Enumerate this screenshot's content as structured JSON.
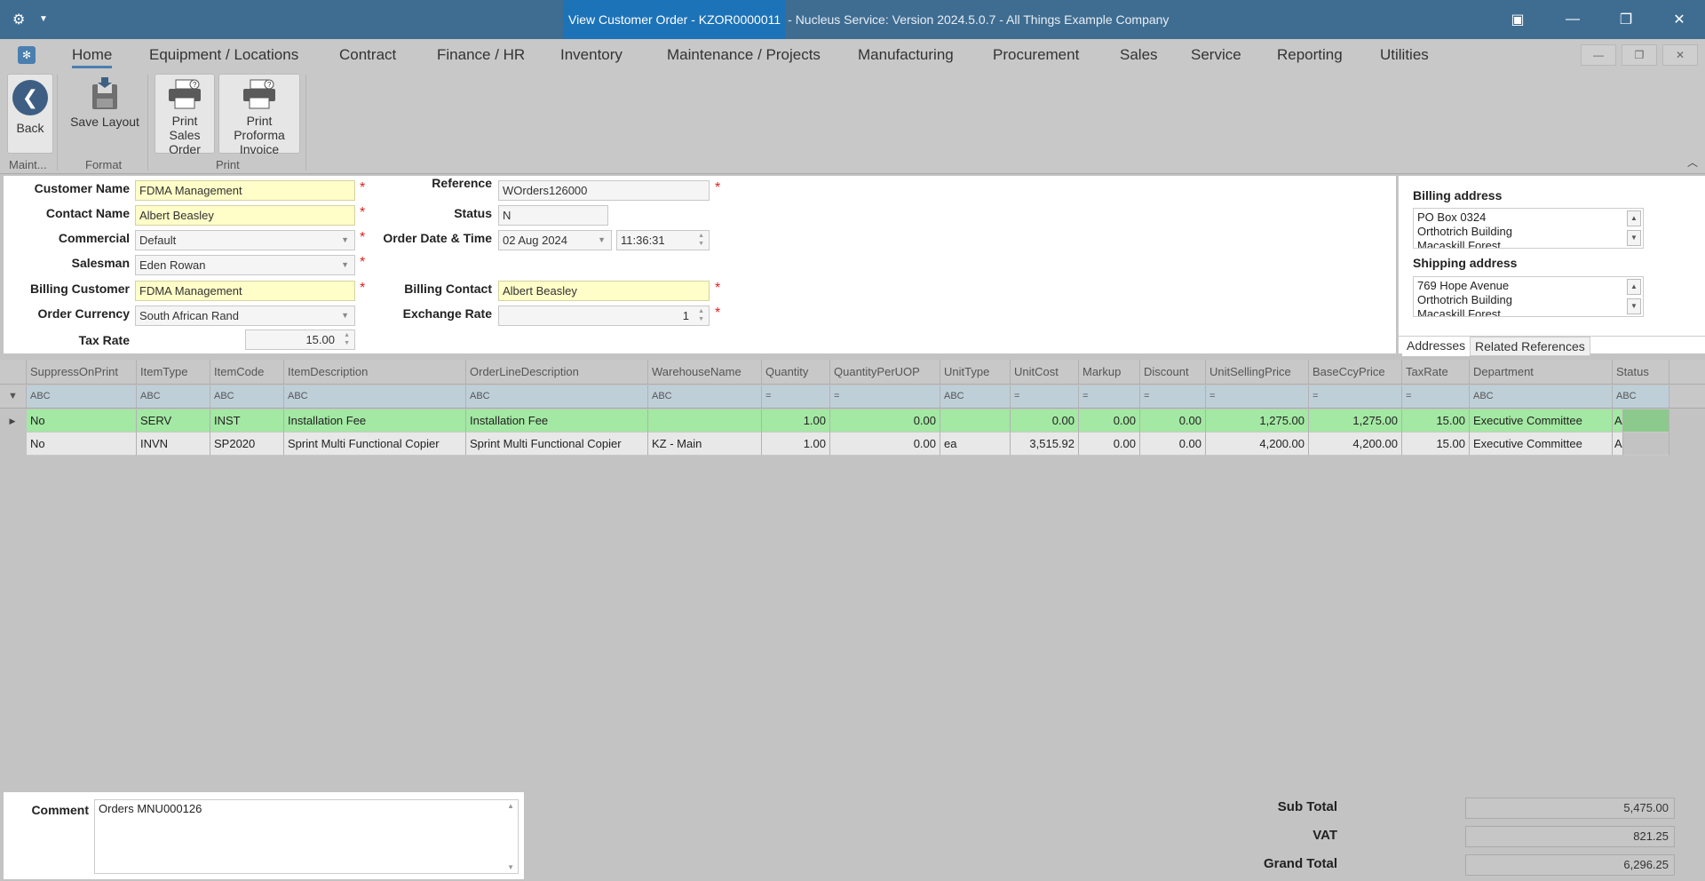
{
  "window": {
    "title_highlight": "View Customer Order - KZOR0000011",
    "title_rest": "- Nucleus Service: Version 2024.5.0.7 - All Things Example Company"
  },
  "menu": {
    "items": [
      "Home",
      "Equipment / Locations",
      "Contract",
      "Finance / HR",
      "Inventory",
      "Maintenance / Projects",
      "Manufacturing",
      "Procurement",
      "Sales",
      "Service",
      "Reporting",
      "Utilities"
    ]
  },
  "ribbon": {
    "back": "Back",
    "save_layout": "Save Layout",
    "print_sales_order": [
      "Print Sales",
      "Order"
    ],
    "print_proforma": [
      "Print Proforma",
      "Invoice"
    ],
    "groups": [
      "Maint...",
      "Format",
      "Print"
    ]
  },
  "form": {
    "customer_name_label": "Customer Name",
    "customer_name": "FDMA Management",
    "contact_name_label": "Contact Name",
    "contact_name": "Albert Beasley",
    "commercial_label": "Commercial",
    "commercial": "Default",
    "salesman_label": "Salesman",
    "salesman": "Eden Rowan",
    "billing_customer_label": "Billing Customer",
    "billing_customer": "FDMA Management",
    "order_currency_label": "Order Currency",
    "order_currency": "South African Rand",
    "tax_rate_label": "Tax Rate",
    "tax_rate": "15.00",
    "reference_label": "Reference",
    "reference": "WOrders126000",
    "status_label": "Status",
    "status": "N",
    "order_date_label": "Order Date & Time",
    "order_date": "02 Aug 2024",
    "order_time": "11:36:31",
    "billing_contact_label": "Billing Contact",
    "billing_contact": "Albert Beasley",
    "exchange_rate_label": "Exchange Rate",
    "exchange_rate": "1",
    "required_mark": "*"
  },
  "addresses": {
    "billing_title": "Billing address",
    "billing_lines": [
      "PO Box 0324",
      "Orthotrich Building",
      "Macaskill Forest"
    ],
    "shipping_title": "Shipping address",
    "shipping_lines": [
      "769 Hope Avenue",
      "Orthotrich Building",
      "Macaskill Forest"
    ],
    "tab_addresses": "Addresses",
    "tab_related": "Related References"
  },
  "grid": {
    "columns": [
      "SuppressOnPrint",
      "ItemType",
      "ItemCode",
      "ItemDescription",
      "OrderLineDescription",
      "WarehouseName",
      "Quantity",
      "QuantityPerUOP",
      "UnitType",
      "UnitCost",
      "Markup",
      "Discount",
      "UnitSellingPrice",
      "BaseCcyPrice",
      "TaxRate",
      "Department",
      "Status"
    ],
    "filters": [
      "ABC",
      "ABC",
      "ABC",
      "ABC",
      "ABC",
      "ABC",
      "=",
      "=",
      "ABC",
      "=",
      "=",
      "=",
      "=",
      "=",
      "=",
      "ABC",
      "ABC"
    ],
    "rows": [
      [
        "No",
        "SERV",
        "INST",
        "Installation Fee",
        "Installation Fee",
        "",
        "1.00",
        "0.00",
        "",
        "0.00",
        "0.00",
        "0.00",
        "1,275.00",
        "1,275.00",
        "15.00",
        "Executive Committee",
        "A"
      ],
      [
        "No",
        "INVN",
        "SP2020",
        "Sprint Multi Functional Copier",
        "Sprint Multi Functional Copier",
        "KZ - Main",
        "1.00",
        "0.00",
        "ea",
        "3,515.92",
        "0.00",
        "0.00",
        "4,200.00",
        "4,200.00",
        "15.00",
        "Executive Committee",
        "A"
      ]
    ]
  },
  "footer": {
    "comment_label": "Comment",
    "comment": "Orders MNU000126",
    "sub_total_label": "Sub Total",
    "sub_total": "5,475.00",
    "vat_label": "VAT",
    "vat": "821.25",
    "grand_total_label": "Grand Total",
    "grand_total": "6,296.25"
  }
}
